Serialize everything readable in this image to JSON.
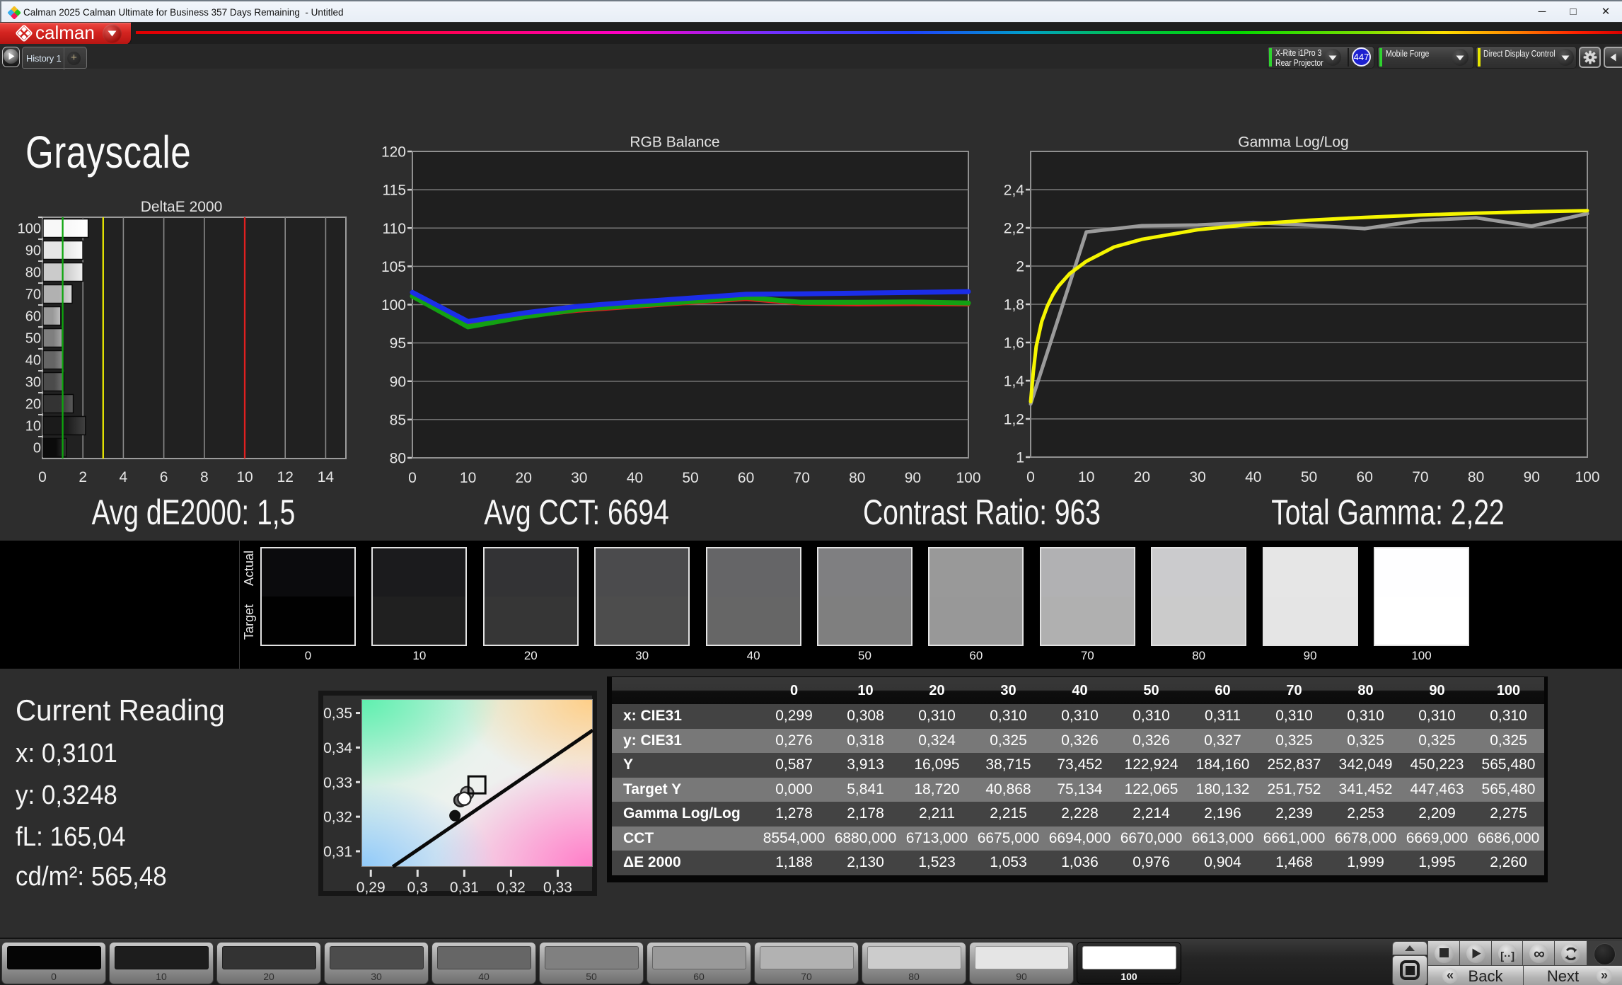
{
  "window": {
    "title": "Calman 2025 Calman Ultimate for Business 357 Days Remaining  - Untitled",
    "controls": {
      "minimize": "minimize",
      "maximize": "maximize",
      "close": "close"
    }
  },
  "brand": {
    "logo_text": "calman"
  },
  "tabs": {
    "history": "History 1",
    "add": "+"
  },
  "devices": {
    "meter": {
      "line1": "X-Rite i1Pro 3",
      "line2": "Rear Projector",
      "stripe_color": "#2fd42f",
      "badge": "447",
      "badge_color": "#1c20cf"
    },
    "source": {
      "label": "Mobile Forge",
      "stripe_color": "#2fd42f"
    },
    "display": {
      "label": "Direct Display Control",
      "stripe_color": "#e6e600"
    }
  },
  "page": {
    "title": "Grayscale"
  },
  "summary": {
    "avg_de": "Avg dE2000: 1,5",
    "avg_cct": "Avg CCT: 6694",
    "contrast": "Contrast Ratio: 963",
    "total_gamma": "Total Gamma: 2,22"
  },
  "chart_data": [
    {
      "id": "deltae",
      "type": "bar",
      "orientation": "horizontal",
      "title": "DeltaE 2000",
      "categories": [
        "0",
        "10",
        "20",
        "30",
        "40",
        "50",
        "60",
        "70",
        "80",
        "90",
        "100"
      ],
      "values": [
        1.188,
        2.13,
        1.523,
        1.053,
        1.036,
        0.976,
        0.904,
        1.468,
        1.999,
        1.995,
        2.26
      ],
      "xlabel": "",
      "ylabel": "",
      "xlim": [
        0,
        15
      ],
      "xticks": [
        0,
        2,
        4,
        6,
        8,
        10,
        12,
        14
      ],
      "xtick_labels": [
        "0",
        "2",
        "4",
        "6",
        "8",
        "10",
        "12",
        "14"
      ],
      "grid": "vertical",
      "reference_lines": [
        {
          "x": 1,
          "color": "#0da50d",
          "name": "green-target-line"
        },
        {
          "x": 3,
          "color": "#e8e800",
          "name": "yellow-warning-line"
        },
        {
          "x": 10,
          "color": "#e02020",
          "name": "red-error-line"
        }
      ],
      "bar_colors": [
        [
          "#0b0b0b",
          "#333333"
        ],
        [
          "#1b1b1b",
          "#414141"
        ],
        [
          "#333333",
          "#5a5a5a"
        ],
        [
          "#4b4b4b",
          "#727272"
        ],
        [
          "#656565",
          "#8c8c8c"
        ],
        [
          "#7f7f7f",
          "#a6a6a6"
        ],
        [
          "#999999",
          "#c0c0c0"
        ],
        [
          "#b1b1b1",
          "#d8d8d8"
        ],
        [
          "#cbcbcb",
          "#efefef"
        ],
        [
          "#e6e6e6",
          "#fbfbfb"
        ],
        [
          "#f8f8f8",
          "#ffffff"
        ]
      ]
    },
    {
      "id": "rgb_balance",
      "type": "line",
      "title": "RGB Balance",
      "x": [
        0,
        10,
        20,
        30,
        40,
        50,
        60,
        70,
        80,
        90,
        100
      ],
      "xtick_labels": [
        "0",
        "10",
        "20",
        "30",
        "40",
        "50",
        "60",
        "70",
        "80",
        "90",
        "100"
      ],
      "ylim": [
        80,
        120
      ],
      "yticks": [
        80,
        85,
        90,
        95,
        100,
        105,
        110,
        115,
        120
      ],
      "ytick_labels": [
        "80",
        "85",
        "90",
        "95",
        "100",
        "105",
        "110",
        "115",
        "120"
      ],
      "grid": "horizontal",
      "legend": "none",
      "series": [
        {
          "name": "Red",
          "color": "#dd1f1f",
          "width": 5,
          "values": [
            101.3,
            97.5,
            98.4,
            99.2,
            99.7,
            100.2,
            100.7,
            100.1,
            100.0,
            100.05,
            100.0
          ]
        },
        {
          "name": "Green",
          "color": "#13a013",
          "width": 7,
          "values": [
            101.1,
            97.1,
            98.4,
            99.4,
            99.9,
            100.4,
            100.95,
            100.3,
            100.3,
            100.35,
            100.2
          ]
        },
        {
          "name": "Blue",
          "color": "#1b2de8",
          "width": 7,
          "values": [
            101.6,
            97.8,
            98.9,
            99.8,
            100.35,
            100.85,
            101.35,
            101.4,
            101.5,
            101.6,
            101.7
          ]
        }
      ]
    },
    {
      "id": "gamma",
      "type": "line",
      "title": "Gamma Log/Log",
      "xtick_labels": [
        "0",
        "10",
        "20",
        "30",
        "40",
        "50",
        "60",
        "70",
        "80",
        "90",
        "100"
      ],
      "ylim": [
        1.0,
        2.6
      ],
      "yticks": [
        1.0,
        1.2,
        1.4,
        1.6,
        1.8,
        2.0,
        2.2,
        2.4
      ],
      "ytick_labels": [
        "1",
        "1,2",
        "1,4",
        "1,6",
        "1,8",
        "2",
        "2,2",
        "2,4"
      ],
      "grid": "horizontal",
      "series": [
        {
          "name": "Measured Gamma",
          "color": "#9b9b9b",
          "width": 5,
          "x": [
            0,
            10,
            20,
            30,
            40,
            50,
            60,
            70,
            80,
            90,
            100
          ],
          "values": [
            1.278,
            2.178,
            2.211,
            2.215,
            2.228,
            2.214,
            2.196,
            2.239,
            2.253,
            2.209,
            2.275
          ]
        },
        {
          "name": "Target Gamma",
          "color": "#f6f600",
          "width": 5,
          "x": [
            0,
            0.5,
            1,
            2,
            3,
            4,
            5,
            7,
            10,
            15,
            20,
            30,
            40,
            50,
            60,
            70,
            80,
            90,
            100
          ],
          "values": [
            1.29,
            1.45,
            1.58,
            1.71,
            1.79,
            1.85,
            1.895,
            1.96,
            2.025,
            2.1,
            2.14,
            2.19,
            2.22,
            2.24,
            2.255,
            2.267,
            2.277,
            2.284,
            2.29
          ]
        }
      ]
    },
    {
      "id": "cie_chromaticity",
      "type": "scatter",
      "title": "",
      "xlim": [
        0.288,
        0.3375
      ],
      "ylim": [
        0.3055,
        0.354
      ],
      "xticks": [
        0.29,
        0.3,
        0.31,
        0.32,
        0.33
      ],
      "xtick_labels": [
        "0,29",
        "0,3",
        "0,31",
        "0,32",
        "0,33"
      ],
      "yticks": [
        0.31,
        0.32,
        0.33,
        0.34,
        0.35
      ],
      "ytick_labels": [
        "0,31",
        "0,32",
        "0,33",
        "0,34",
        "0,35"
      ],
      "locus_line": {
        "color": "#0a0a0a",
        "width": 5,
        "points": [
          [
            0.2947,
            0.3055
          ],
          [
            0.3375,
            0.345
          ]
        ]
      },
      "markers": [
        {
          "name": "black-reading-dot",
          "shape": "circle",
          "x": 0.308,
          "y": 0.3203,
          "r": 8,
          "fill": "#111111",
          "stroke": "none"
        },
        {
          "name": "gray-reading-dot",
          "shape": "circle",
          "x": 0.3092,
          "y": 0.3248,
          "r": 9,
          "fill": "#6e6e6e",
          "stroke": "#1a1a1a"
        },
        {
          "name": "light-reading-dot",
          "shape": "circle",
          "x": 0.3106,
          "y": 0.3268,
          "r": 9,
          "fill": "#9d9d9d",
          "stroke": "#2a2a2a"
        },
        {
          "name": "white-reading-dot",
          "shape": "circle",
          "x": 0.31,
          "y": 0.3252,
          "r": 9,
          "fill": "#ffffff",
          "stroke": "#2a2a2a"
        },
        {
          "name": "target-square",
          "shape": "square",
          "x": 0.3127,
          "y": 0.3292,
          "r": 12,
          "fill": "none",
          "stroke": "#0a0a0a"
        }
      ]
    }
  ],
  "swatch_strip": {
    "row_labels": [
      "Actual",
      "Target"
    ],
    "levels": [
      "0",
      "10",
      "20",
      "30",
      "40",
      "50",
      "60",
      "70",
      "80",
      "90",
      "100"
    ],
    "actual_colors": [
      "#0b0b0d",
      "#1b1b1d",
      "#333335",
      "#4b4b4d",
      "#656567",
      "#7f7f81",
      "#999999",
      "#b1b1b3",
      "#cbcbcd",
      "#e6e6e6",
      "#fefeff"
    ],
    "target_colors": [
      "#010101",
      "#202020",
      "#363636",
      "#4d4d4d",
      "#666666",
      "#7f7f7f",
      "#989898",
      "#b0b0b0",
      "#cbcbcb",
      "#e5e5e5",
      "#ffffff"
    ]
  },
  "reading": {
    "title": "Current Reading",
    "lines": [
      "x: 0,3101",
      "y: 0,3248",
      "fL: 165,04",
      "cd/m²: 565,48"
    ]
  },
  "table": {
    "columns": [
      "0",
      "10",
      "20",
      "30",
      "40",
      "50",
      "60",
      "70",
      "80",
      "90",
      "100"
    ],
    "rows": [
      {
        "label": "x: CIE31",
        "shade": "dark",
        "values": [
          "0,299",
          "0,308",
          "0,310",
          "0,310",
          "0,310",
          "0,310",
          "0,311",
          "0,310",
          "0,310",
          "0,310",
          "0,310"
        ]
      },
      {
        "label": "y: CIE31",
        "shade": "light",
        "values": [
          "0,276",
          "0,318",
          "0,324",
          "0,325",
          "0,326",
          "0,326",
          "0,327",
          "0,325",
          "0,325",
          "0,325",
          "0,325"
        ]
      },
      {
        "label": "Y",
        "shade": "dark",
        "values": [
          "0,587",
          "3,913",
          "16,095",
          "38,715",
          "73,452",
          "122,924",
          "184,160",
          "252,837",
          "342,049",
          "450,223",
          "565,480"
        ]
      },
      {
        "label": "Target Y",
        "shade": "light",
        "values": [
          "0,000",
          "5,841",
          "18,720",
          "40,868",
          "75,134",
          "122,065",
          "180,132",
          "251,752",
          "341,452",
          "447,463",
          "565,480"
        ]
      },
      {
        "label": "Gamma Log/Log",
        "shade": "dark",
        "values": [
          "1,278",
          "2,178",
          "2,211",
          "2,215",
          "2,228",
          "2,214",
          "2,196",
          "2,239",
          "2,253",
          "2,209",
          "2,275"
        ]
      },
      {
        "label": "CCT",
        "shade": "light",
        "values": [
          "8554,000",
          "6880,000",
          "6713,000",
          "6675,000",
          "6694,000",
          "6670,000",
          "6613,000",
          "6661,000",
          "6678,000",
          "6669,000",
          "6686,000"
        ]
      },
      {
        "label": "ΔE 2000",
        "shade": "dark",
        "values": [
          "1,188",
          "2,130",
          "1,523",
          "1,053",
          "1,036",
          "0,976",
          "0,904",
          "1,468",
          "1,999",
          "1,995",
          "2,260"
        ]
      }
    ]
  },
  "toolbar": {
    "levels": [
      "0",
      "10",
      "20",
      "30",
      "40",
      "50",
      "60",
      "70",
      "80",
      "90",
      "100"
    ],
    "level_colors": [
      "#050505",
      "#1d1d1d",
      "#333333",
      "#4c4c4c",
      "#666666",
      "#808080",
      "#999999",
      "#b2b2b2",
      "#cccccc",
      "#e5e5e5",
      "#ffffff"
    ],
    "selected_level": "100",
    "transport": [
      "stop",
      "play",
      "bracket",
      "infinity",
      "refresh"
    ],
    "back_label": "Back",
    "next_label": "Next",
    "back_chevrons": "«",
    "next_chevrons": "»"
  }
}
